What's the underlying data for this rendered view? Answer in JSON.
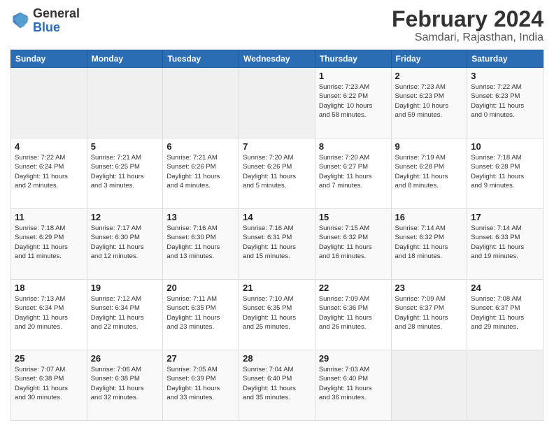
{
  "header": {
    "logo_general": "General",
    "logo_blue": "Blue",
    "month_year": "February 2024",
    "location": "Samdari, Rajasthan, India"
  },
  "days_of_week": [
    "Sunday",
    "Monday",
    "Tuesday",
    "Wednesday",
    "Thursday",
    "Friday",
    "Saturday"
  ],
  "weeks": [
    [
      {
        "day": "",
        "info": ""
      },
      {
        "day": "",
        "info": ""
      },
      {
        "day": "",
        "info": ""
      },
      {
        "day": "",
        "info": ""
      },
      {
        "day": "1",
        "info": "Sunrise: 7:23 AM\nSunset: 6:22 PM\nDaylight: 10 hours\nand 58 minutes."
      },
      {
        "day": "2",
        "info": "Sunrise: 7:23 AM\nSunset: 6:23 PM\nDaylight: 10 hours\nand 59 minutes."
      },
      {
        "day": "3",
        "info": "Sunrise: 7:22 AM\nSunset: 6:23 PM\nDaylight: 11 hours\nand 0 minutes."
      }
    ],
    [
      {
        "day": "4",
        "info": "Sunrise: 7:22 AM\nSunset: 6:24 PM\nDaylight: 11 hours\nand 2 minutes."
      },
      {
        "day": "5",
        "info": "Sunrise: 7:21 AM\nSunset: 6:25 PM\nDaylight: 11 hours\nand 3 minutes."
      },
      {
        "day": "6",
        "info": "Sunrise: 7:21 AM\nSunset: 6:26 PM\nDaylight: 11 hours\nand 4 minutes."
      },
      {
        "day": "7",
        "info": "Sunrise: 7:20 AM\nSunset: 6:26 PM\nDaylight: 11 hours\nand 5 minutes."
      },
      {
        "day": "8",
        "info": "Sunrise: 7:20 AM\nSunset: 6:27 PM\nDaylight: 11 hours\nand 7 minutes."
      },
      {
        "day": "9",
        "info": "Sunrise: 7:19 AM\nSunset: 6:28 PM\nDaylight: 11 hours\nand 8 minutes."
      },
      {
        "day": "10",
        "info": "Sunrise: 7:18 AM\nSunset: 6:28 PM\nDaylight: 11 hours\nand 9 minutes."
      }
    ],
    [
      {
        "day": "11",
        "info": "Sunrise: 7:18 AM\nSunset: 6:29 PM\nDaylight: 11 hours\nand 11 minutes."
      },
      {
        "day": "12",
        "info": "Sunrise: 7:17 AM\nSunset: 6:30 PM\nDaylight: 11 hours\nand 12 minutes."
      },
      {
        "day": "13",
        "info": "Sunrise: 7:16 AM\nSunset: 6:30 PM\nDaylight: 11 hours\nand 13 minutes."
      },
      {
        "day": "14",
        "info": "Sunrise: 7:16 AM\nSunset: 6:31 PM\nDaylight: 11 hours\nand 15 minutes."
      },
      {
        "day": "15",
        "info": "Sunrise: 7:15 AM\nSunset: 6:32 PM\nDaylight: 11 hours\nand 16 minutes."
      },
      {
        "day": "16",
        "info": "Sunrise: 7:14 AM\nSunset: 6:32 PM\nDaylight: 11 hours\nand 18 minutes."
      },
      {
        "day": "17",
        "info": "Sunrise: 7:14 AM\nSunset: 6:33 PM\nDaylight: 11 hours\nand 19 minutes."
      }
    ],
    [
      {
        "day": "18",
        "info": "Sunrise: 7:13 AM\nSunset: 6:34 PM\nDaylight: 11 hours\nand 20 minutes."
      },
      {
        "day": "19",
        "info": "Sunrise: 7:12 AM\nSunset: 6:34 PM\nDaylight: 11 hours\nand 22 minutes."
      },
      {
        "day": "20",
        "info": "Sunrise: 7:11 AM\nSunset: 6:35 PM\nDaylight: 11 hours\nand 23 minutes."
      },
      {
        "day": "21",
        "info": "Sunrise: 7:10 AM\nSunset: 6:35 PM\nDaylight: 11 hours\nand 25 minutes."
      },
      {
        "day": "22",
        "info": "Sunrise: 7:09 AM\nSunset: 6:36 PM\nDaylight: 11 hours\nand 26 minutes."
      },
      {
        "day": "23",
        "info": "Sunrise: 7:09 AM\nSunset: 6:37 PM\nDaylight: 11 hours\nand 28 minutes."
      },
      {
        "day": "24",
        "info": "Sunrise: 7:08 AM\nSunset: 6:37 PM\nDaylight: 11 hours\nand 29 minutes."
      }
    ],
    [
      {
        "day": "25",
        "info": "Sunrise: 7:07 AM\nSunset: 6:38 PM\nDaylight: 11 hours\nand 30 minutes."
      },
      {
        "day": "26",
        "info": "Sunrise: 7:06 AM\nSunset: 6:38 PM\nDaylight: 11 hours\nand 32 minutes."
      },
      {
        "day": "27",
        "info": "Sunrise: 7:05 AM\nSunset: 6:39 PM\nDaylight: 11 hours\nand 33 minutes."
      },
      {
        "day": "28",
        "info": "Sunrise: 7:04 AM\nSunset: 6:40 PM\nDaylight: 11 hours\nand 35 minutes."
      },
      {
        "day": "29",
        "info": "Sunrise: 7:03 AM\nSunset: 6:40 PM\nDaylight: 11 hours\nand 36 minutes."
      },
      {
        "day": "",
        "info": ""
      },
      {
        "day": "",
        "info": ""
      }
    ]
  ]
}
